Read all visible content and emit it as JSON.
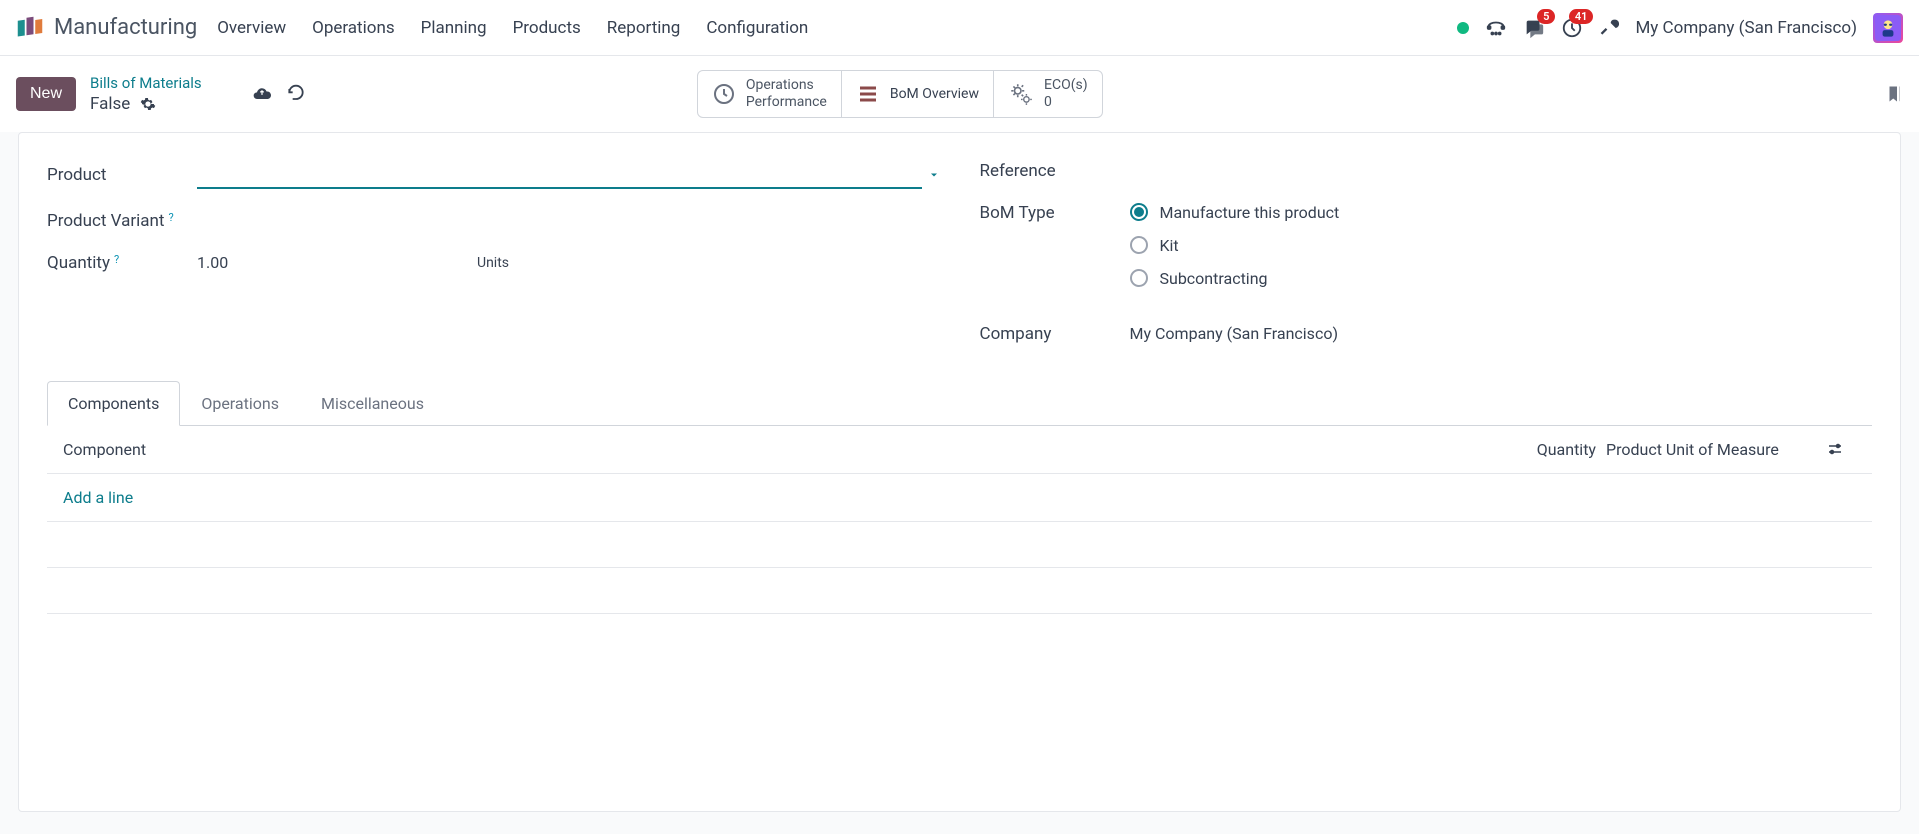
{
  "app": {
    "title": "Manufacturing"
  },
  "nav": {
    "items": [
      "Overview",
      "Operations",
      "Planning",
      "Products",
      "Reporting",
      "Configuration"
    ]
  },
  "topright": {
    "messages_badge": "5",
    "activities_badge": "41",
    "company": "My Company (San Francisco)"
  },
  "controlbar": {
    "new_label": "New",
    "breadcrumb": "Bills of Materials",
    "record_name": "False"
  },
  "statboxes": {
    "ops_line1": "Operations",
    "ops_line2": "Performance",
    "bom_overview": "BoM Overview",
    "eco_line1": "ECO(s)",
    "eco_line2": "0"
  },
  "form": {
    "labels": {
      "product": "Product",
      "product_variant": "Product Variant",
      "quantity": "Quantity",
      "reference": "Reference",
      "bom_type": "BoM Type",
      "company": "Company"
    },
    "quantity_value": "1.00",
    "quantity_uom": "Units",
    "bom_type": {
      "manufacture": "Manufacture this product",
      "kit": "Kit",
      "subcontracting": "Subcontracting"
    },
    "company_value": "My Company (San Francisco)"
  },
  "tabs": {
    "components": "Components",
    "operations": "Operations",
    "misc": "Miscellaneous"
  },
  "table": {
    "headers": {
      "component": "Component",
      "quantity": "Quantity",
      "uom": "Product Unit of Measure"
    },
    "add_line": "Add a line"
  }
}
